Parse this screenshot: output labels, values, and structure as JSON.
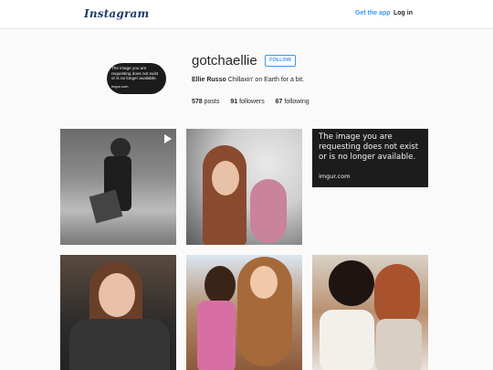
{
  "header": {
    "logo_text": "Instagram",
    "get_app_label": "Get the app",
    "login_label": "Log in"
  },
  "profile": {
    "avatar_text": {
      "lines": [
        "The image you are",
        "requesting does not exist",
        "or is no longer available."
      ],
      "brand": "imgur.com"
    },
    "username": "gotchaellie",
    "follow_label": "FOLLOW",
    "full_name": "Ellie Russo",
    "bio": "Chillaxin' on Earth for a bit.",
    "stats": {
      "posts": {
        "count": "578",
        "label": "posts"
      },
      "followers": {
        "count": "91",
        "label": "followers"
      },
      "following": {
        "count": "67",
        "label": "following"
      }
    }
  },
  "posts": {
    "unavailable": {
      "lines": [
        "The image you are",
        "requesting does not exist",
        "or is no longer available."
      ],
      "brand": "imgur.com"
    }
  },
  "colors": {
    "accent": "#3897f0",
    "logo": "#1f3c66",
    "background": "#fafafa"
  }
}
